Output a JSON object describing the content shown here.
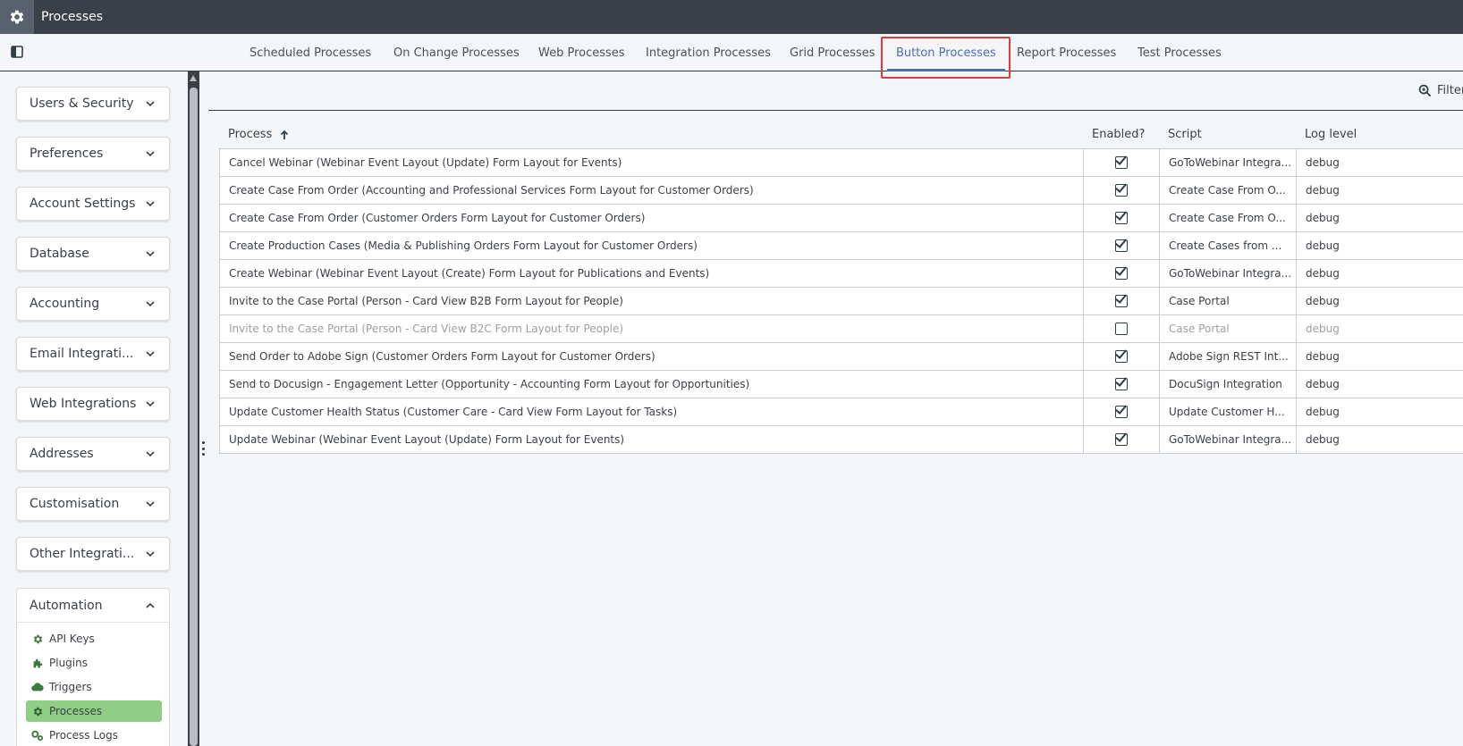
{
  "app": {
    "title": "Processes",
    "icon": "gear-icon"
  },
  "tabs": [
    {
      "label": "Scheduled Processes",
      "active": false
    },
    {
      "label": "On Change Processes",
      "active": false
    },
    {
      "label": "Web Processes",
      "active": false
    },
    {
      "label": "Integration Processes",
      "active": false
    },
    {
      "label": "Grid Processes",
      "active": false
    },
    {
      "label": "Button Processes",
      "active": true
    },
    {
      "label": "Report Processes",
      "active": false
    },
    {
      "label": "Test Processes",
      "active": false
    }
  ],
  "sidebar": {
    "sections": [
      {
        "label": "Users & Security"
      },
      {
        "label": "Preferences"
      },
      {
        "label": "Account Settings"
      },
      {
        "label": "Database"
      },
      {
        "label": "Accounting"
      },
      {
        "label": "Email Integrati..."
      },
      {
        "label": "Web Integrations"
      },
      {
        "label": "Addresses"
      },
      {
        "label": "Customisation"
      },
      {
        "label": "Other Integrati..."
      }
    ],
    "open_section": {
      "label": "Automation",
      "items": [
        {
          "label": "API Keys",
          "icon": "gear-icon",
          "active": false
        },
        {
          "label": "Plugins",
          "icon": "puzzle-icon",
          "active": false
        },
        {
          "label": "Triggers",
          "icon": "cloud-icon",
          "active": false
        },
        {
          "label": "Processes",
          "icon": "gear-icon",
          "active": true
        },
        {
          "label": "Process Logs",
          "icon": "gears-icon",
          "active": false
        }
      ]
    }
  },
  "toolbar": {
    "filter_label": "Filter"
  },
  "grid": {
    "columns": {
      "process": "Process",
      "enabled": "Enabled?",
      "script": "Script",
      "log_level": "Log level"
    },
    "sort": {
      "column": "process",
      "direction": "ascending"
    },
    "rows": [
      {
        "process": "Cancel Webinar (Webinar Event Layout (Update) Form Layout for Events)",
        "enabled": true,
        "script": "GoToWebinar Integra...",
        "log_level": "debug"
      },
      {
        "process": "Create Case From Order (Accounting and Professional Services Form Layout for Customer Orders)",
        "enabled": true,
        "script": "Create Case From O...",
        "log_level": "debug"
      },
      {
        "process": "Create Case From Order (Customer Orders Form Layout for Customer Orders)",
        "enabled": true,
        "script": "Create Case From O...",
        "log_level": "debug"
      },
      {
        "process": "Create Production Cases (Media & Publishing Orders Form Layout for Customer Orders)",
        "enabled": true,
        "script": "Create Cases from ...",
        "log_level": "debug"
      },
      {
        "process": "Create Webinar (Webinar Event Layout (Create) Form Layout for Publications and Events)",
        "enabled": true,
        "script": "GoToWebinar Integra...",
        "log_level": "debug"
      },
      {
        "process": "Invite to the Case Portal (Person - Card View B2B Form Layout for People)",
        "enabled": true,
        "script": "Case Portal",
        "log_level": "debug"
      },
      {
        "process": "Invite to the Case Portal (Person - Card View B2C Form Layout for People)",
        "enabled": false,
        "script": "Case Portal",
        "log_level": "debug"
      },
      {
        "process": "Send Order to Adobe Sign (Customer Orders Form Layout for Customer Orders)",
        "enabled": true,
        "script": "Adobe Sign REST Int...",
        "log_level": "debug"
      },
      {
        "process": "Send to Docusign - Engagement Letter (Opportunity - Accounting Form Layout for Opportunities)",
        "enabled": true,
        "script": "DocuSign Integration",
        "log_level": "debug"
      },
      {
        "process": "Update Customer Health Status (Customer Care - Card View Form Layout for Tasks)",
        "enabled": true,
        "script": "Update Customer H...",
        "log_level": "debug"
      },
      {
        "process": "Update Webinar (Webinar Event Layout (Update) Form Layout for Events)",
        "enabled": true,
        "script": "GoToWebinar Integra...",
        "log_level": "debug"
      }
    ]
  },
  "colors": {
    "topbar": "#3b4048",
    "accent": "#4a6fb3",
    "active_nav": "#8fcf85",
    "highlight": "#e0393e"
  }
}
